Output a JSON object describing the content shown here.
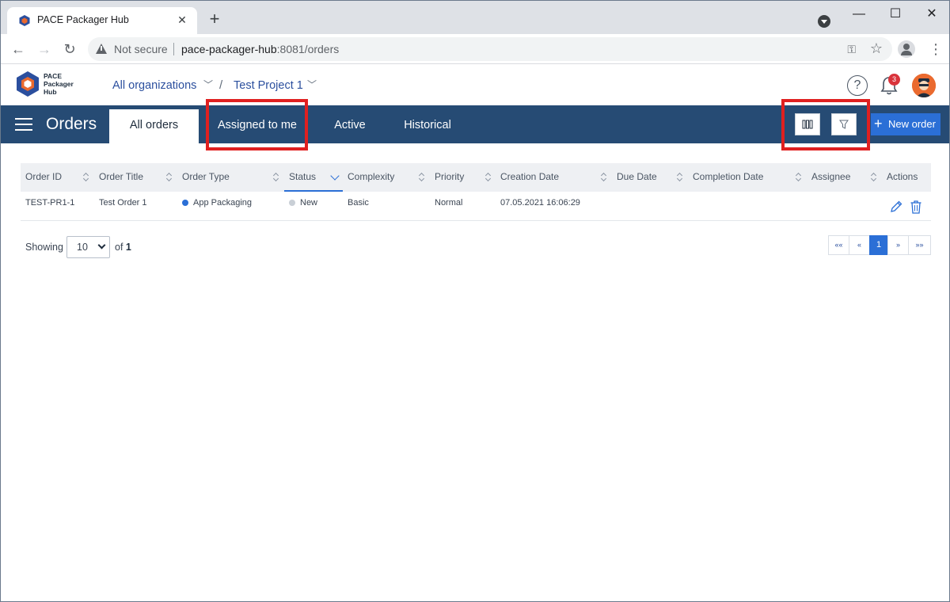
{
  "browser": {
    "tab_title": "PACE Packager Hub",
    "tab_close": "✕",
    "new_tab": "+",
    "security_label": "Not secure",
    "url_host": "pace-packager-hub",
    "url_port_path": ":8081/orders",
    "window_controls": {
      "minimize": "—",
      "maximize": "☐",
      "close": "✕"
    }
  },
  "header": {
    "logo_lines": [
      "PACE",
      "Packager",
      "Hub"
    ],
    "org_crumb": "All organizations",
    "crumb_separator": "/",
    "project_crumb": "Test Project 1",
    "help_symbol": "?",
    "notification_count": "3"
  },
  "navbar": {
    "title": "Orders",
    "tabs": [
      {
        "label": "All orders",
        "active": true
      },
      {
        "label": "Assigned to me",
        "active": false
      },
      {
        "label": "Active",
        "active": false
      },
      {
        "label": "Historical",
        "active": false
      }
    ],
    "new_order_icon": "+",
    "new_order_label": "New order",
    "colors": {
      "bar": "#264b74",
      "primary": "#2b6fd6",
      "highlight": "#e02020"
    }
  },
  "table": {
    "columns": [
      "Order ID",
      "Order Title",
      "Order Type",
      "Status",
      "Complexity",
      "Priority",
      "Creation Date",
      "Due Date",
      "Completion Date",
      "Assignee",
      "Actions"
    ],
    "rows": [
      {
        "order_id": "TEST-PR1-1",
        "order_title": "Test Order 1",
        "order_type": "App Packaging",
        "status": "New",
        "complexity": "Basic",
        "priority": "Normal",
        "creation_date": "07.05.2021 16:06:29",
        "due_date": "",
        "completion_date": "",
        "assignee": ""
      }
    ]
  },
  "pagination": {
    "showing_label": "Showing",
    "page_size": "10",
    "of_label": "of",
    "total_pages": "1",
    "first": "««",
    "prev": "«",
    "current": "1",
    "next": "»",
    "last": "»»"
  }
}
